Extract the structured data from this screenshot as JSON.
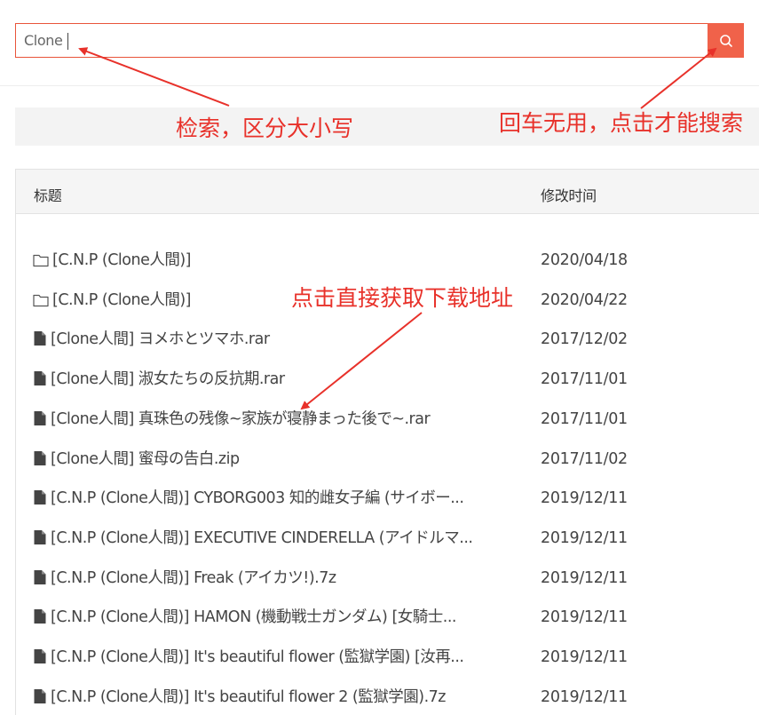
{
  "search": {
    "value": "Clone",
    "button_icon": "search-icon"
  },
  "table": {
    "headers": {
      "title": "标题",
      "modified": "修改时间"
    },
    "rows": [
      {
        "type": "folder",
        "icon": "folder-icon",
        "name": "[C.N.P (Clone人間)]",
        "date": "2020/04/18"
      },
      {
        "type": "folder",
        "icon": "folder-icon",
        "name": "[C.N.P (Clone人間)]",
        "date": "2020/04/22"
      },
      {
        "type": "file",
        "icon": "file-icon",
        "name": "[Clone人間] ヨメホとツマホ.rar",
        "date": "2017/12/02"
      },
      {
        "type": "file",
        "icon": "file-icon",
        "name": "[Clone人間] 淑女たちの反抗期.rar",
        "date": "2017/11/01"
      },
      {
        "type": "file",
        "icon": "file-icon",
        "name": "[Clone人間] 真珠色の残像~家族が寝静まった後で~.rar",
        "date": "2017/11/01"
      },
      {
        "type": "file",
        "icon": "file-icon",
        "name": "[Clone人間] 蜜母の告白.zip",
        "date": "2017/11/02"
      },
      {
        "type": "file",
        "icon": "file-icon",
        "name": "[C.N.P (Clone人間)] CYBORG003 知的雌女子編 (サイボー...",
        "date": "2019/12/11"
      },
      {
        "type": "file",
        "icon": "file-icon",
        "name": "[C.N.P (Clone人間)] EXECUTIVE CINDERELLA (アイドルマ...",
        "date": "2019/12/11"
      },
      {
        "type": "file",
        "icon": "file-icon",
        "name": "[C.N.P (Clone人間)] Freak (アイカツ!).7z",
        "date": "2019/12/11"
      },
      {
        "type": "file",
        "icon": "file-icon",
        "name": "[C.N.P (Clone人間)] HAMON (機動戦士ガンダム) [女騎士...",
        "date": "2019/12/11"
      },
      {
        "type": "file",
        "icon": "file-icon",
        "name": "[C.N.P (Clone人間)] It's beautiful flower (監獄学園) [汝再...",
        "date": "2019/12/11"
      },
      {
        "type": "file",
        "icon": "file-icon",
        "name": "[C.N.P (Clone人間)] It's beautiful flower 2 (監獄学園).7z",
        "date": "2019/12/11"
      }
    ]
  },
  "annotations": {
    "search_note": "检索，区分大小写",
    "enter_note": "回车无用，点击才能搜索",
    "download_note": "点击直接获取下载地址",
    "color": "#e8312a"
  },
  "colors": {
    "accent": "#f0624a",
    "border": "#e8543a"
  }
}
